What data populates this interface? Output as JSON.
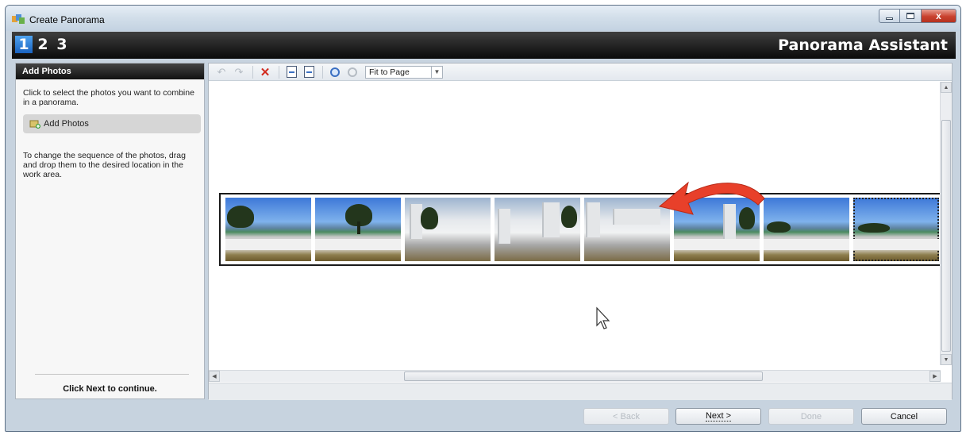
{
  "window": {
    "title": "Create Panorama",
    "caption_close": "x"
  },
  "header": {
    "steps": [
      "1",
      "2",
      "3"
    ],
    "active_step": "1",
    "assistant_title": "Panorama Assistant"
  },
  "left_panel": {
    "heading": "Add Photos",
    "instruction": "Click to select the photos you want to combine in a panorama.",
    "add_button_label": "Add Photos",
    "sequence_hint": "To change the sequence of the photos, drag and drop them to the desired location in the work area.",
    "footer": "Click Next to continue."
  },
  "toolbar": {
    "zoom_value": "Fit to Page",
    "icons": [
      "undo-icon",
      "redo-icon",
      "delete-icon",
      "rotate-left-icon",
      "rotate-right-icon",
      "zoom-in-icon",
      "zoom-out-icon"
    ],
    "delete_color": "#d22b1f"
  },
  "photo_strip": {
    "photo_count": 8,
    "selected_index": 7
  },
  "buttons": {
    "back": "< Back",
    "next": "Next >",
    "done": "Done",
    "cancel": "Cancel"
  },
  "colors": {
    "active_step": "#2a7ad8",
    "annotation_arrow": "#e8402a",
    "header_bg": "#111111"
  }
}
